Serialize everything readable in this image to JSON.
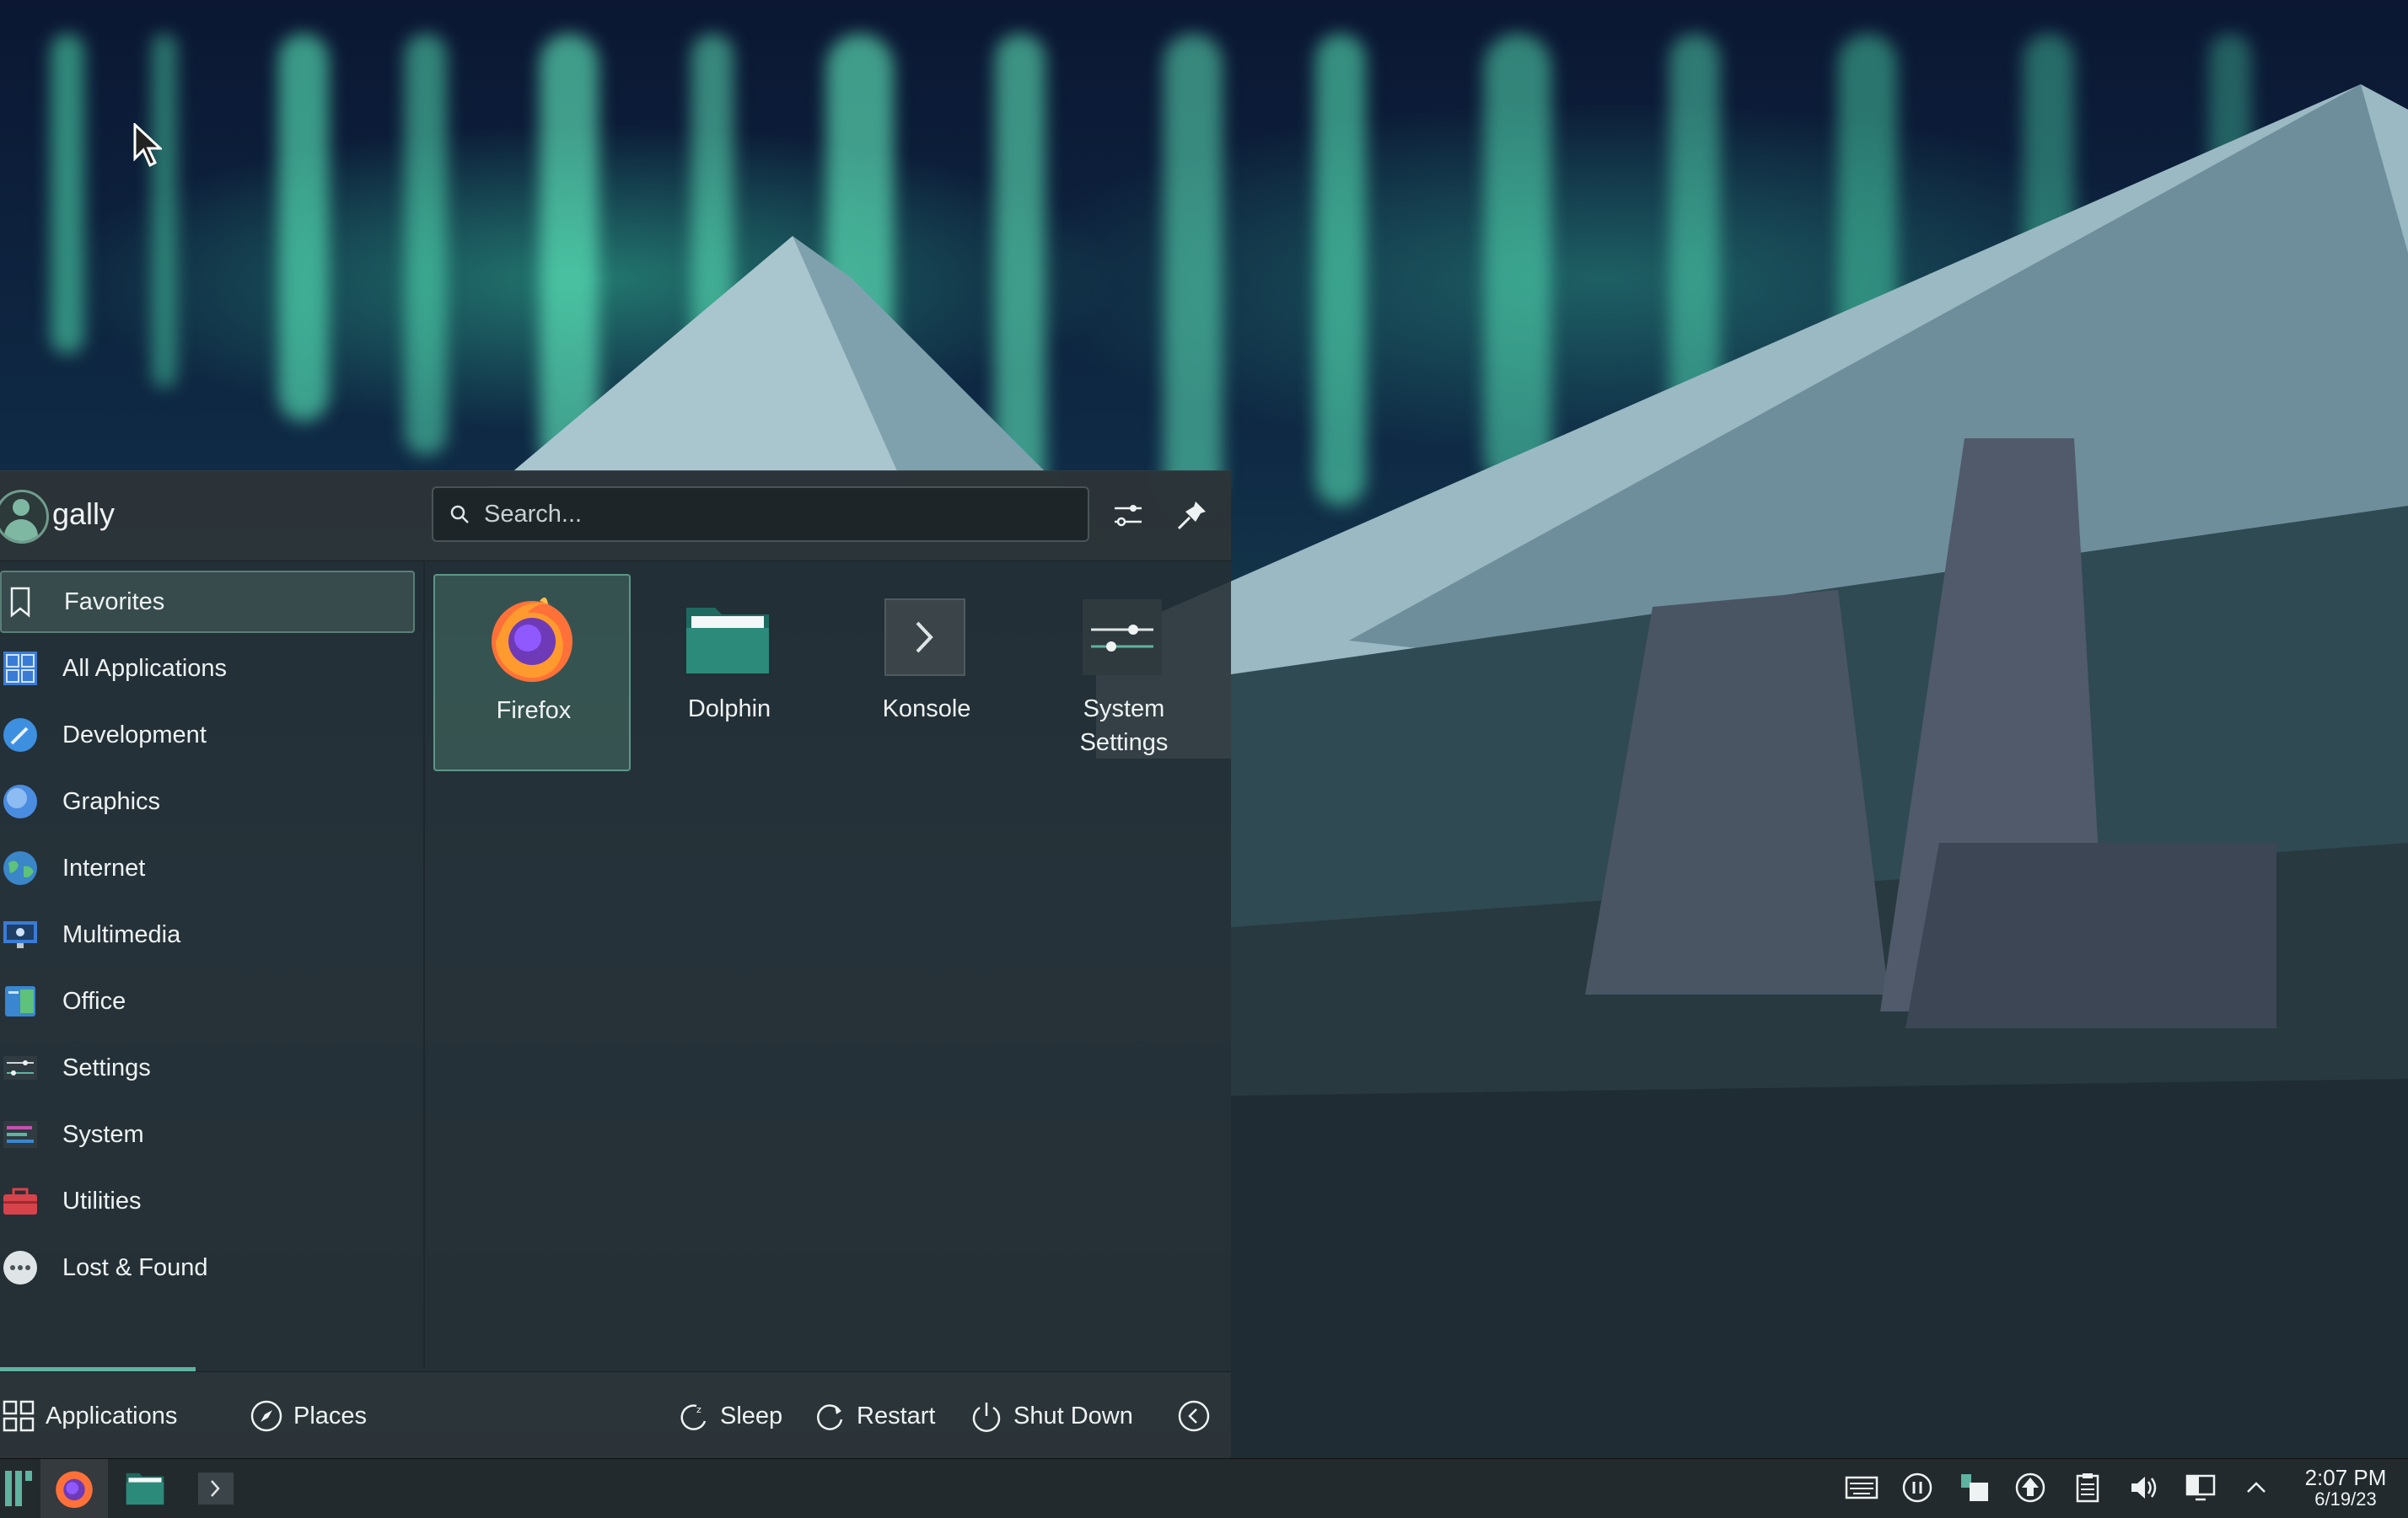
{
  "launcher": {
    "username": "gally",
    "search_placeholder": "Search...",
    "categories": [
      {
        "label": "Favorites",
        "icon": "bookmark-icon"
      },
      {
        "label": "All Applications",
        "icon": "grid-icon"
      },
      {
        "label": "Development",
        "icon": "development-icon"
      },
      {
        "label": "Graphics",
        "icon": "graphics-icon"
      },
      {
        "label": "Internet",
        "icon": "globe-icon"
      },
      {
        "label": "Multimedia",
        "icon": "multimedia-icon"
      },
      {
        "label": "Office",
        "icon": "office-icon"
      },
      {
        "label": "Settings",
        "icon": "settings-icon"
      },
      {
        "label": "System",
        "icon": "system-icon"
      },
      {
        "label": "Utilities",
        "icon": "toolbox-icon"
      },
      {
        "label": "Lost & Found",
        "icon": "more-icon"
      }
    ],
    "apps": [
      {
        "label": "Firefox",
        "icon": "firefox-icon"
      },
      {
        "label": "Dolphin",
        "icon": "folder-icon"
      },
      {
        "label": "Konsole",
        "icon": "terminal-icon"
      },
      {
        "label": "System Settings",
        "line1": "System",
        "line2": "Settings",
        "icon": "system-settings-icon"
      }
    ],
    "footer": {
      "applications": "Applications",
      "places": "Places",
      "sleep": "Sleep",
      "restart": "Restart",
      "shutdown": "Shut Down"
    }
  },
  "taskbar": {
    "clock_time": "2:07 PM",
    "clock_date": "6/19/23"
  },
  "colors": {
    "accent": "#5fb3a0",
    "panel": "#232a2d",
    "launcher_bg": "#262f34"
  }
}
